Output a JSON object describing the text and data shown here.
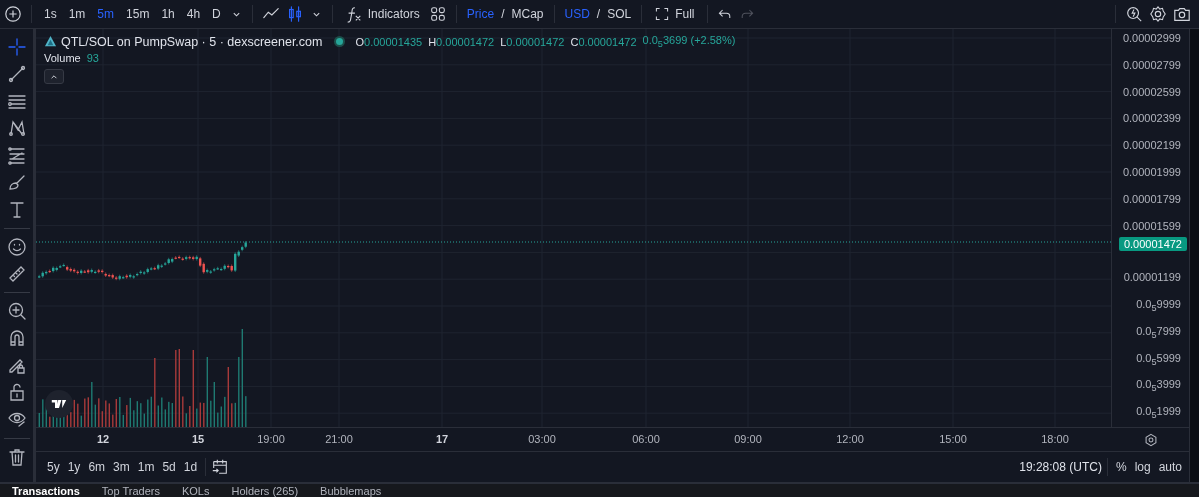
{
  "toolbar": {
    "intervals": [
      {
        "label": "1s",
        "selected": false
      },
      {
        "label": "1m",
        "selected": false
      },
      {
        "label": "5m",
        "selected": true
      },
      {
        "label": "15m",
        "selected": false
      },
      {
        "label": "1h",
        "selected": false
      },
      {
        "label": "4h",
        "selected": false
      },
      {
        "label": "D",
        "selected": false
      }
    ],
    "chart_types": [
      {
        "selected": false
      },
      {
        "selected": true
      }
    ],
    "indicators": "Indicators",
    "price_toggle": {
      "options": [
        {
          "label": "Price",
          "selected": true
        },
        {
          "label": "MCap",
          "selected": false
        }
      ],
      "separator": "/"
    },
    "currency_toggle": {
      "options": [
        {
          "label": "USD",
          "selected": true
        },
        {
          "label": "SOL",
          "selected": false
        }
      ],
      "separator": "/"
    },
    "full": "Full"
  },
  "tools": [
    {
      "selected": true
    },
    {
      "selected": false
    },
    {
      "selected": false
    },
    {
      "selected": false
    },
    {
      "selected": false
    },
    {
      "selected": false
    },
    {
      "selected": false
    },
    {
      "selected": false
    },
    {
      "selected": false
    },
    {
      "selected": false
    },
    {
      "selected": false
    },
    {
      "selected": false
    },
    {
      "selected": false
    },
    {
      "selected": false
    },
    {
      "selected": false
    }
  ],
  "legend": {
    "symbol": "QTL/SOL on PumpSwap · 5 · dexscreener.com",
    "ohlc": [
      {
        "key": "O",
        "value": "0.00001435"
      },
      {
        "key": "H",
        "value": "0.00001472"
      },
      {
        "key": "L",
        "value": "0.00001472"
      },
      {
        "key": "C",
        "value": "0.00001472"
      }
    ],
    "change": "0.0$_{5}$3699 (+2.58%)",
    "volume_label": "Volume",
    "volume_value": "93"
  },
  "price_axis": {
    "labels": [
      "0.00002999",
      "0.00002799",
      "0.00002599",
      "0.00002399",
      "0.00002199",
      "0.00001999",
      "0.00001799",
      "0.00001599",
      "0.00001199",
      "0.0$_{5}$9999",
      "0.0$_{5}$7999",
      "0.0$_{5}$5999",
      "0.0$_{5}$3999",
      "0.0$_{5}$1999"
    ],
    "current_price": "0.00001472"
  },
  "time_axis": [
    {
      "label": "12",
      "kind": "day"
    },
    {
      "label": "15",
      "kind": "day"
    },
    {
      "label": "19:00",
      "kind": "time"
    },
    {
      "label": "21:00",
      "kind": "time"
    },
    {
      "label": "17",
      "kind": "day"
    },
    {
      "label": "03:00",
      "kind": "time"
    },
    {
      "label": "06:00",
      "kind": "time"
    },
    {
      "label": "09:00",
      "kind": "time"
    },
    {
      "label": "12:00",
      "kind": "time"
    },
    {
      "label": "15:00",
      "kind": "time"
    },
    {
      "label": "18:00",
      "kind": "time"
    }
  ],
  "ranges": [
    "5y",
    "1y",
    "6m",
    "3m",
    "1m",
    "5d",
    "1d"
  ],
  "clock": "19:28:08 (UTC)",
  "scale_options": [
    "%",
    "log",
    "auto"
  ],
  "bottom_tabs": [
    {
      "label": "Transactions",
      "selected": true
    },
    {
      "label": "Top Traders",
      "selected": false
    },
    {
      "label": "KOLs",
      "selected": false
    },
    {
      "label": "Holders (265)",
      "selected": false
    },
    {
      "label": "Bubblemaps",
      "selected": false
    }
  ]
}
